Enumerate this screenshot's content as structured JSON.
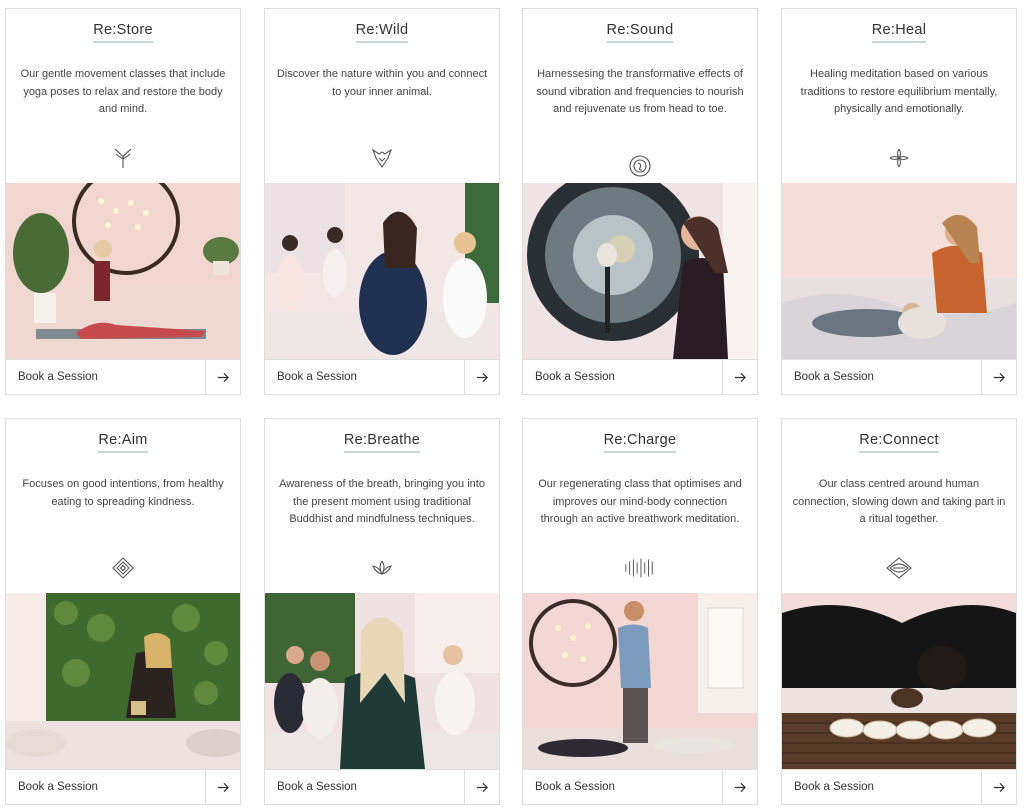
{
  "cards": [
    {
      "title": "Re:Store",
      "description": "Our gentle movement classes that include yoga poses to relax and restore the body and mind.",
      "icon": "yoga-pose-icon",
      "photo": "woman in yoga pose under a circular chandelier",
      "cta": "Book a Session",
      "arrow": "arrow-right-icon"
    },
    {
      "title": "Re:Wild",
      "description": "Discover the nature within you and connect to your inner animal.",
      "icon": "animal-head-icon",
      "photo": "women meditating in a group",
      "cta": "Book a Session",
      "arrow": "arrow-right-icon"
    },
    {
      "title": "Re:Sound",
      "description": "Harnessesing the transformative effects of sound vibration and frequencies to nourish and rejuvenate us from head to toe.",
      "icon": "sound-ring-icon",
      "photo": "woman playing a gong",
      "cta": "Book a Session",
      "arrow": "arrow-right-icon"
    },
    {
      "title": "Re:Heal",
      "description": "Healing meditation based on various traditions to restore equilibrium mentally, physically and emotionally.",
      "icon": "flower-cross-icon",
      "photo": "healer treating a reclining man",
      "cta": "Book a Session",
      "arrow": "arrow-right-icon"
    },
    {
      "title": "Re:Aim",
      "description": "Focuses on good intentions, from healthy eating to spreading kindness.",
      "icon": "nested-diamond-icon",
      "photo": "woman seated in front of a green plant wall",
      "cta": "Book a Session",
      "arrow": "arrow-right-icon"
    },
    {
      "title": "Re:Breathe",
      "description": "Awareness of the breath, bringing you into the present moment using traditional Buddhist and mindfulness techniques.",
      "icon": "lotus-icon",
      "photo": "women meditating with eyes closed",
      "cta": "Book a Session",
      "arrow": "arrow-right-icon"
    },
    {
      "title": "Re:Charge",
      "description": "Our regenerating class that optimises and improves our mind-body connection through an active breathwork meditation.",
      "icon": "sound-wave-icon",
      "photo": "instructor leading breathwork class",
      "cta": "Book a Session",
      "arrow": "arrow-right-icon"
    },
    {
      "title": "Re:Connect",
      "description": "Our class centred around human connection, slowing down and taking part in a ritual together.",
      "icon": "diamond-eye-icon",
      "photo": "tea ceremony with cups on a mat",
      "cta": "Book a Session",
      "arrow": "arrow-right-icon"
    }
  ]
}
